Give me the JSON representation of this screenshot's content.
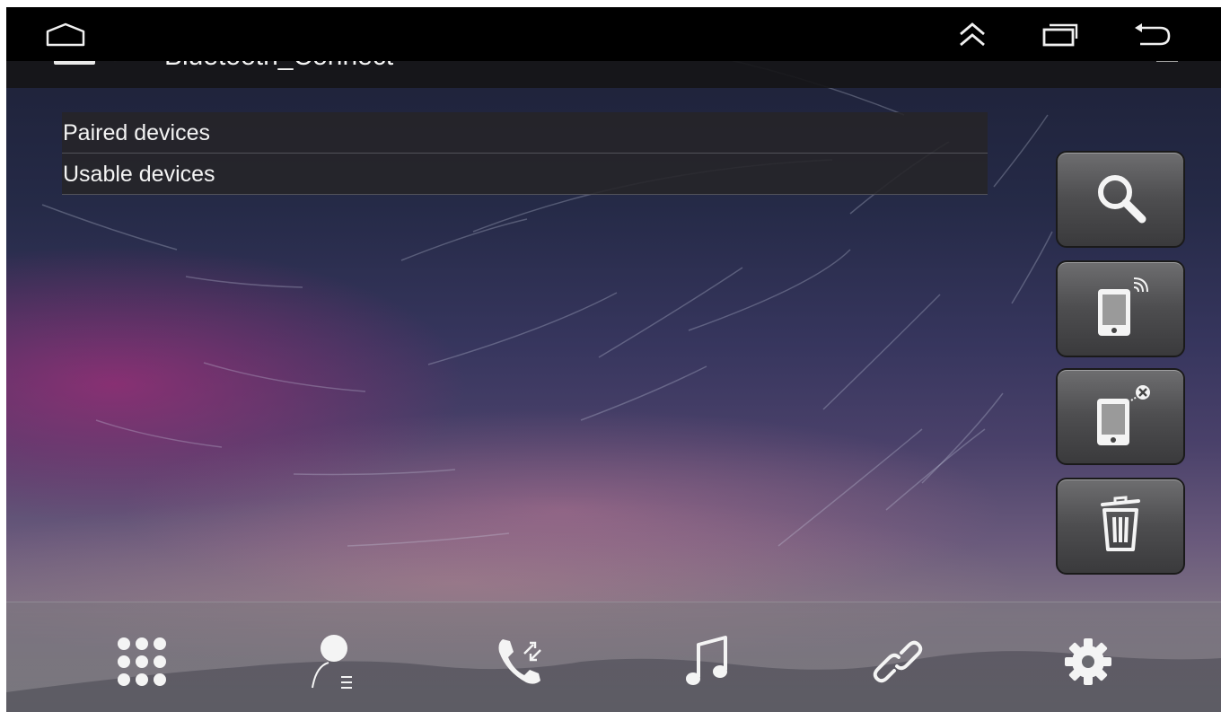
{
  "app": {
    "title": "Bluetooth_Connect"
  },
  "status_bar": {
    "home_icon": "home-outline-icon",
    "expand_icon": "double-chevron-up-icon",
    "recents_icon": "recent-apps-icon",
    "back_icon": "back-arrow-icon"
  },
  "device_list": {
    "paired_label": "Paired devices",
    "usable_label": "Usable devices"
  },
  "side_buttons": [
    {
      "name": "search-devices",
      "icon": "magnifier-icon"
    },
    {
      "name": "connect-phone",
      "icon": "phone-signal-icon"
    },
    {
      "name": "disconnect-phone",
      "icon": "phone-x-icon"
    },
    {
      "name": "delete-device",
      "icon": "trash-icon"
    }
  ],
  "bottom_nav": [
    {
      "name": "dialpad",
      "icon": "dialpad-icon"
    },
    {
      "name": "contacts",
      "icon": "contacts-icon"
    },
    {
      "name": "call-log",
      "icon": "call-log-icon"
    },
    {
      "name": "music",
      "icon": "music-note-icon"
    },
    {
      "name": "connection",
      "icon": "link-icon"
    },
    {
      "name": "settings",
      "icon": "gear-icon"
    }
  ],
  "colors": {
    "status_bar": "#000000",
    "list_row_bg": "#262428",
    "list_text": "#f3f3f3",
    "button_face": "#555557",
    "icon_white": "#f2f2f2"
  }
}
